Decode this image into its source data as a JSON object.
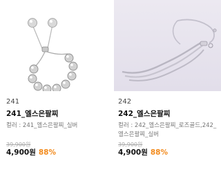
{
  "products": [
    {
      "number": "241",
      "title": "241_엘스은팔찌",
      "option": "컬러 : 241_엘스은팔찌_실버",
      "original_price": "39,900원",
      "price": "4,900원",
      "discount": "88%",
      "image_icon": "bracelet-ball-chain-icon"
    },
    {
      "number": "242",
      "title": "242_엘스은팔찌",
      "option": "컬러 : 242_엘스은팔찌_로즈골드,242_엘스은팔찌_실버",
      "original_price": "39,900원",
      "price": "4,900원",
      "discount": "88%",
      "image_icon": "bracelet-snake-chain-icon"
    }
  ],
  "colors": {
    "discount": "#f28a1c",
    "card_right_bg": "#ece9f1"
  }
}
